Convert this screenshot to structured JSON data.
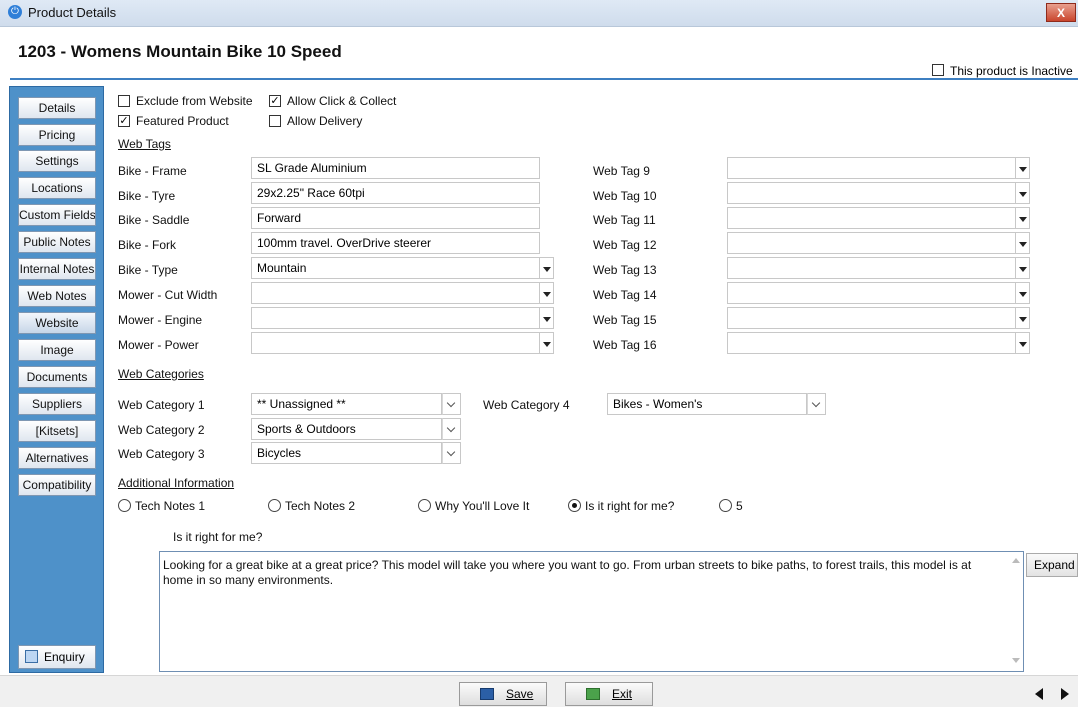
{
  "window": {
    "title": "Product Details",
    "close_label": "X",
    "app_icon_glyph": "⏻"
  },
  "product": {
    "title": "1203 - Womens Mountain Bike 10 Speed",
    "inactive_label": "This product is Inactive",
    "inactive_checked": false
  },
  "sidebar": {
    "items": [
      {
        "label": "Details"
      },
      {
        "label": "Pricing"
      },
      {
        "label": "Settings"
      },
      {
        "label": "Locations"
      },
      {
        "label": "Custom Fields"
      },
      {
        "label": "Public Notes"
      },
      {
        "label": "Internal Notes"
      },
      {
        "label": "Web Notes"
      },
      {
        "label": "Website"
      },
      {
        "label": "Image"
      },
      {
        "label": "Documents"
      },
      {
        "label": "Suppliers"
      },
      {
        "label": "[Kitsets]"
      },
      {
        "label": "Alternatives"
      },
      {
        "label": "Compatibility"
      }
    ],
    "active": "Website",
    "enquiry_label": "Enquiry"
  },
  "options": {
    "exclude_label": "Exclude from Website",
    "exclude_checked": false,
    "click_collect_label": "Allow Click & Collect",
    "click_collect_checked": true,
    "featured_label": "Featured Product",
    "featured_checked": true,
    "delivery_label": "Allow Delivery",
    "delivery_checked": false
  },
  "web_tags": {
    "section_label": "Web Tags",
    "left": [
      {
        "label": "Bike - Frame",
        "value": "SL Grade Aluminium"
      },
      {
        "label": "Bike - Tyre",
        "value": "29x2.25\" Race 60tpi"
      },
      {
        "label": "Bike - Saddle",
        "value": "Forward"
      },
      {
        "label": "Bike - Fork",
        "value": "100mm travel. OverDrive steerer"
      },
      {
        "label": "Bike - Type",
        "value": "Mountain"
      },
      {
        "label": "Mower - Cut Width",
        "value": ""
      },
      {
        "label": "Mower - Engine",
        "value": ""
      },
      {
        "label": "Mower - Power",
        "value": ""
      }
    ],
    "right": [
      {
        "label": "Web Tag 9",
        "value": ""
      },
      {
        "label": "Web Tag 10",
        "value": ""
      },
      {
        "label": "Web Tag 11",
        "value": ""
      },
      {
        "label": "Web Tag 12",
        "value": ""
      },
      {
        "label": "Web Tag 13",
        "value": ""
      },
      {
        "label": "Web Tag 14",
        "value": ""
      },
      {
        "label": "Web Tag 15",
        "value": ""
      },
      {
        "label": "Web Tag 16",
        "value": ""
      }
    ]
  },
  "web_categories": {
    "section_label": "Web Categories",
    "cat1_label": "Web Category 1",
    "cat1_value": "** Unassigned **",
    "cat2_label": "Web Category 2",
    "cat2_value": "Sports & Outdoors",
    "cat3_label": "Web Category 3",
    "cat3_value": "Bicycles",
    "cat4_label": "Web Category 4",
    "cat4_value": "Bikes - Women's"
  },
  "additional": {
    "section_label": "Additional Information",
    "radios": [
      {
        "label": "Tech Notes 1",
        "selected": false
      },
      {
        "label": "Tech Notes 2",
        "selected": false
      },
      {
        "label": "Why You'll Love It",
        "selected": false
      },
      {
        "label": "Is it right for me?",
        "selected": true
      },
      {
        "label": "5",
        "selected": false
      }
    ],
    "heading": "Is it right for me?",
    "text": "Looking for a great bike at a great price?  This model will take you where you want to go.  From urban streets to bike paths, to forest trails, this model is at home in so many environments.",
    "expand_label": "Expand"
  },
  "footer": {
    "save_label": "Save",
    "exit_label": "Exit"
  },
  "colors": {
    "sidebar": "#4e91c9",
    "header_line": "#3e7fc1",
    "close": "#c9452d"
  }
}
